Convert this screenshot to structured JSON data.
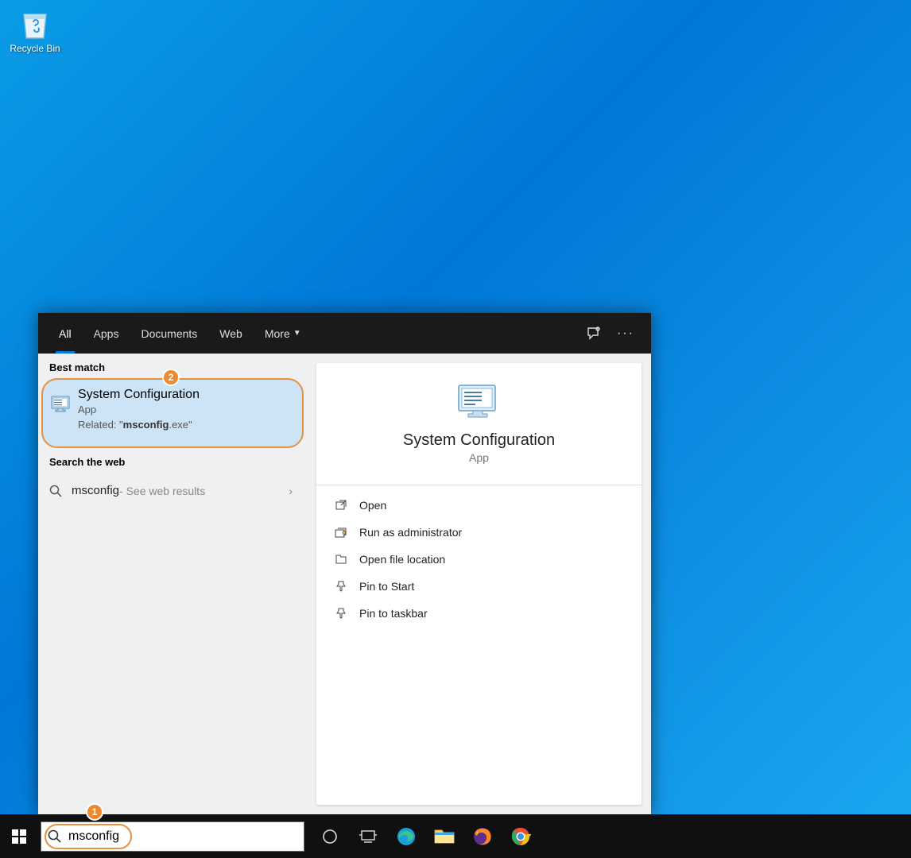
{
  "desktop": {
    "recycle_bin_label": "Recycle Bin"
  },
  "search": {
    "tabs": {
      "all": "All",
      "apps": "Apps",
      "documents": "Documents",
      "web": "Web",
      "more": "More"
    },
    "sections": {
      "best_match": "Best match",
      "search_web": "Search the web"
    },
    "best_match": {
      "title": "System Configuration",
      "subtitle": "App",
      "related_prefix": "Related: \"",
      "related_bold": "msconfig",
      "related_suffix": ".exe\""
    },
    "web_result": {
      "query": "msconfig",
      "hint": " - See web results"
    },
    "badges": {
      "best_match": "2",
      "search_box": "1"
    }
  },
  "preview": {
    "title": "System Configuration",
    "subtitle": "App",
    "actions": {
      "open": "Open",
      "run_admin": "Run as administrator",
      "open_location": "Open file location",
      "pin_start": "Pin to Start",
      "pin_taskbar": "Pin to taskbar"
    }
  },
  "taskbar": {
    "search_value": "msconfig"
  }
}
